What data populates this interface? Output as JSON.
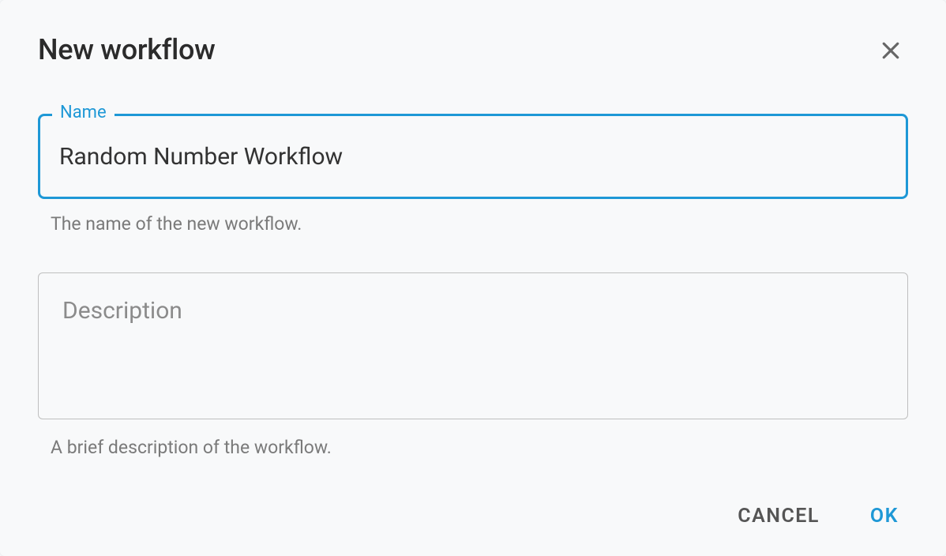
{
  "dialog": {
    "title": "New workflow",
    "fields": {
      "name": {
        "label": "Name",
        "value": "Random Number Workflow",
        "help": "The name of the new workflow."
      },
      "description": {
        "placeholder": "Description",
        "value": "",
        "help": "A brief description of the workflow."
      }
    },
    "buttons": {
      "cancel": "CANCEL",
      "ok": "OK"
    }
  }
}
